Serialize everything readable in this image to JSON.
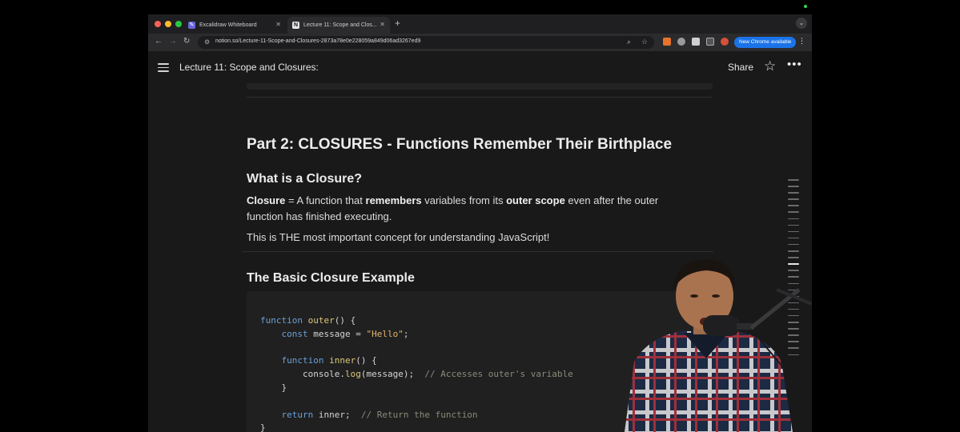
{
  "browser": {
    "tabs": [
      {
        "title": "Excalidraw Whiteboard",
        "active": false
      },
      {
        "title": "Lecture 11: Scope and Clos...",
        "active": true
      }
    ],
    "url": "notion.so/Lecture-11-Scope-and-Closures-2873a78e0e228059a849d06ad3267ed9",
    "update_button": "New Chrome available"
  },
  "notion": {
    "page_title": "Lecture 11: Scope and Closures:",
    "share_label": "Share"
  },
  "content": {
    "heading_part2": "Part 2: CLOSURES - Functions Remember Their Birthplace",
    "heading_what": "What is a Closure?",
    "def_term": "Closure",
    "def_t1": " = A function that ",
    "def_b1": "remembers",
    "def_t2": " variables from its ",
    "def_b2": "outer scope",
    "def_t3": " even after the outer function has finished executing.",
    "importance": "This is THE most important concept for understanding JavaScript!",
    "heading_example": "The Basic Closure Example",
    "code": {
      "l1_kw": "function",
      "l1_fn": "outer",
      "l1_rest": "() {",
      "l2_kw": "const",
      "l2_var": " message = ",
      "l2_str": "\"Hello\"",
      "l2_end": ";",
      "l4_kw": "function",
      "l4_fn": "inner",
      "l4_rest": "() {",
      "l5_obj": "console.",
      "l5_fn": "log",
      "l5_rest": "(message);  ",
      "l5_cm": "// Accesses outer's variable",
      "l6": "}",
      "l8_kw": "return",
      "l8_rest": " inner;  ",
      "l8_cm": "// Return the function",
      "l9": "}"
    }
  },
  "colors": {
    "background": "#191919",
    "chrome_blue": "#1a73e8",
    "keyword": "#6aa0d8",
    "function": "#dcc97a",
    "string": "#e0b56f",
    "comment": "#8a8a7a"
  }
}
